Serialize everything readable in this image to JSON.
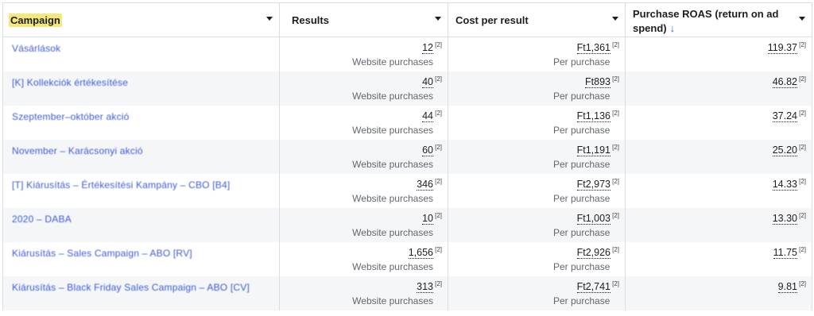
{
  "header": {
    "campaign": "Campaign",
    "results": "Results",
    "cost_per_result": "Cost per result",
    "purchase_roas": "Purchase ROAS (return on ad spend)",
    "sort_arrow": "↓"
  },
  "rows": [
    {
      "campaign": "Vásárlások",
      "results": "12",
      "results_ref": "[2]",
      "results_sub": "Website purchases",
      "cost": "Ft1,361",
      "cost_ref": "[2]",
      "cost_sub": "Per purchase",
      "roas": "119.37",
      "roas_ref": "[2]"
    },
    {
      "campaign": "[K] Kollekciók értékesítése",
      "results": "40",
      "results_ref": "[2]",
      "results_sub": "Website purchases",
      "cost": "Ft893",
      "cost_ref": "[2]",
      "cost_sub": "Per purchase",
      "roas": "46.82",
      "roas_ref": "[2]"
    },
    {
      "campaign": "Szeptember–október akció",
      "results": "44",
      "results_ref": "[2]",
      "results_sub": "Website purchases",
      "cost": "Ft1,136",
      "cost_ref": "[2]",
      "cost_sub": "Per purchase",
      "roas": "37.24",
      "roas_ref": "[2]"
    },
    {
      "campaign": "November – Karácsonyi akció",
      "results": "60",
      "results_ref": "[2]",
      "results_sub": "Website purchases",
      "cost": "Ft1,191",
      "cost_ref": "[2]",
      "cost_sub": "Per purchase",
      "roas": "25.20",
      "roas_ref": "[2]"
    },
    {
      "campaign": "[T] Kiárusítás – Értékesítési Kampány – CBO [B4]",
      "results": "346",
      "results_ref": "[2]",
      "results_sub": "Website purchases",
      "cost": "Ft2,973",
      "cost_ref": "[2]",
      "cost_sub": "Per purchase",
      "roas": "14.33",
      "roas_ref": "[2]"
    },
    {
      "campaign": "2020 – DABA",
      "results": "10",
      "results_ref": "[2]",
      "results_sub": "Website purchases",
      "cost": "Ft1,003",
      "cost_ref": "[2]",
      "cost_sub": "Per purchase",
      "roas": "13.30",
      "roas_ref": "[2]"
    },
    {
      "campaign": "Kiárusítás – Sales Campaign – ABO [RV]",
      "results": "1,656",
      "results_ref": "[2]",
      "results_sub": "Website purchases",
      "cost": "Ft2,926",
      "cost_ref": "[2]",
      "cost_sub": "Per purchase",
      "roas": "11.75",
      "roas_ref": "[2]"
    },
    {
      "campaign": "Kiárusítás – Black Friday Sales Campaign – ABO [CV]",
      "results": "313",
      "results_ref": "[2]",
      "results_sub": "Website purchases",
      "cost": "Ft2,741",
      "cost_ref": "[2]",
      "cost_sub": "Per purchase",
      "roas": "9.81",
      "roas_ref": "[2]"
    }
  ]
}
